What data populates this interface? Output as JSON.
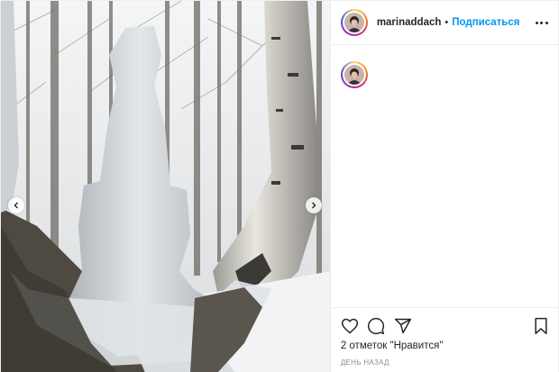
{
  "post": {
    "username": "marinaddach",
    "separator": "•",
    "follow_label": "Подписаться",
    "likes_text": "2 отметок \"Нравится\"",
    "timestamp": "День назад"
  },
  "icons": {
    "more": "more-options-icon",
    "like": "heart-icon",
    "comment": "comment-icon",
    "share": "paper-plane-icon",
    "save": "bookmark-icon",
    "prev": "chevron-left-icon",
    "next": "chevron-right-icon"
  },
  "colors": {
    "accent": "#0095f6",
    "text": "#262626",
    "muted": "#8e8e8e",
    "border": "#efefef"
  }
}
